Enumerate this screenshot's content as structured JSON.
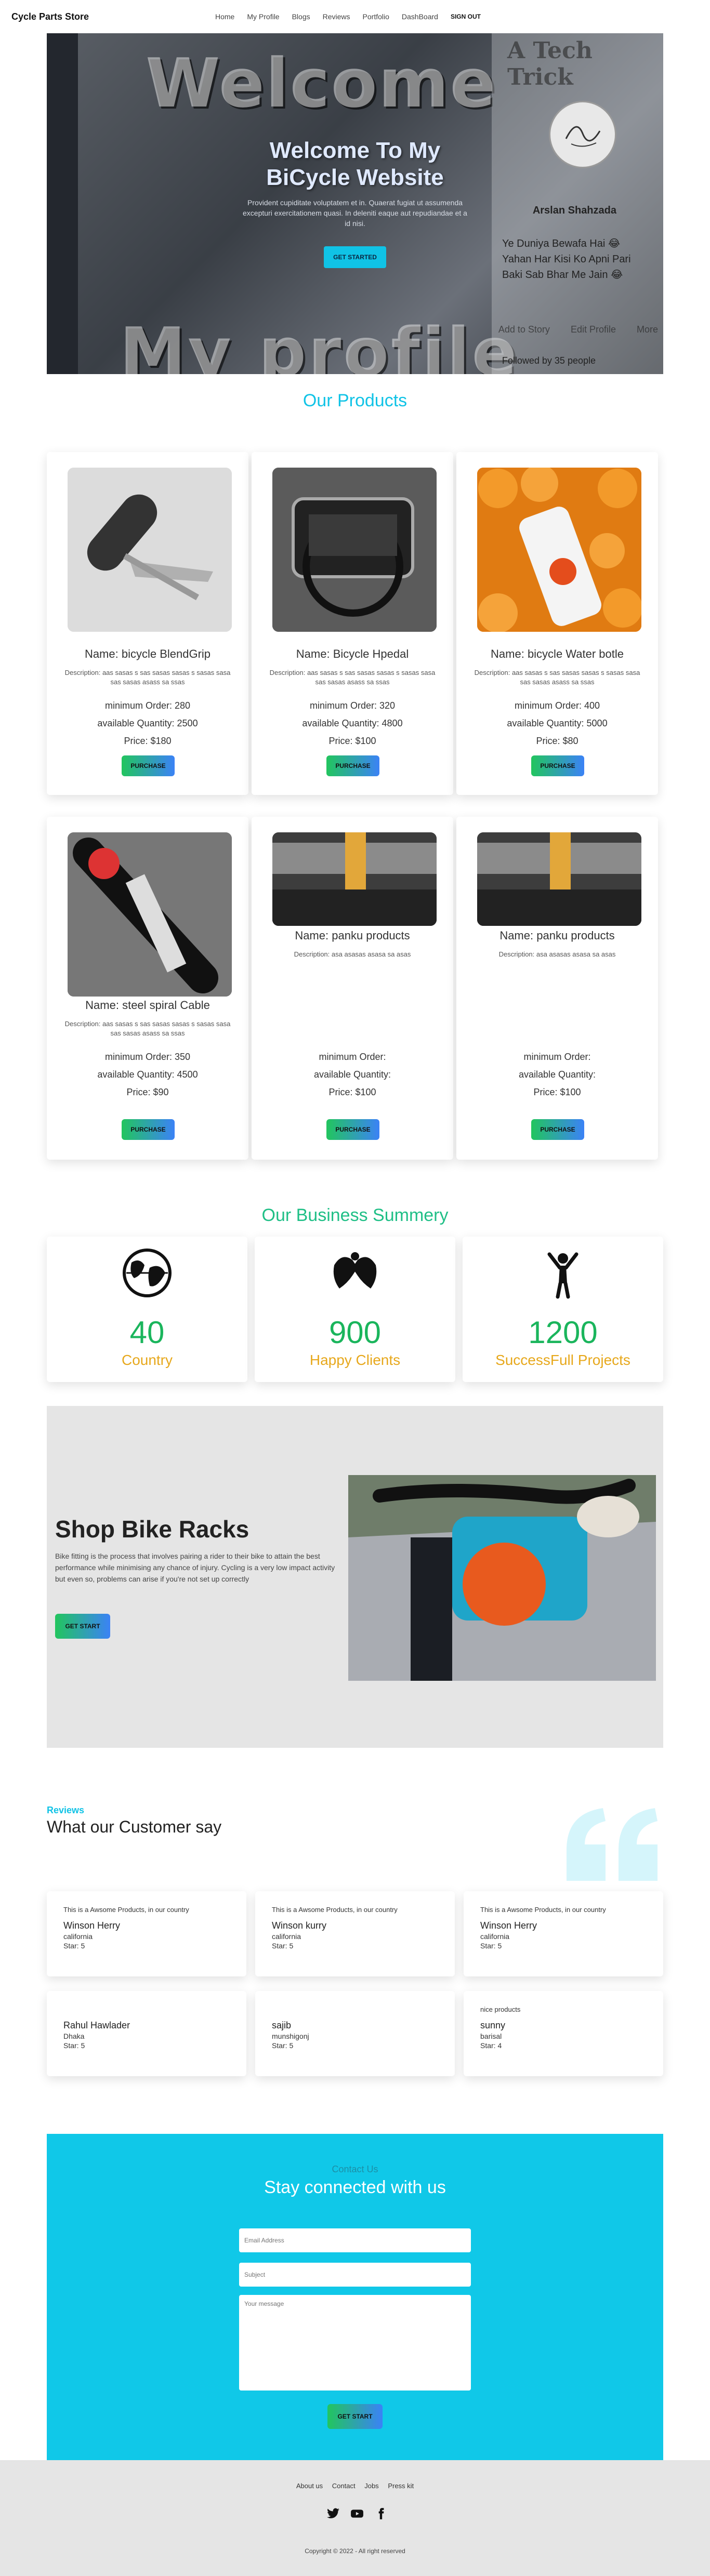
{
  "navbar": {
    "brand": "Cycle Parts Store",
    "links": [
      "Home",
      "My Profile",
      "Blogs",
      "Reviews",
      "Portfolio",
      "DashBoard"
    ],
    "signout": "SIGN OUT"
  },
  "hero": {
    "title_line1": "Welcome To My",
    "title_line2": "BiCycle Website",
    "subtitle": "Provident cupiditate voluptatem et in. Quaerat fugiat ut assumenda excepturi exercitationem quasi. In deleniti eaque aut repudiandae et a id nisi.",
    "button": "GET STARTED",
    "bg_word1": "Welcome",
    "bg_word2": "My profile",
    "side_tag": "A Tech Trick",
    "profile_name": "Arslan Shahzada",
    "profile_quote": "Ye Duniya Bewafa Hai 😂 Yahan Har Kisi Ko Apni Pari Baki Sab Bhar Me Jain 😂",
    "profile_actions": [
      "Add to Story",
      "Edit Profile",
      "More"
    ],
    "followers": "Followed by 35 people"
  },
  "products_section": {
    "title": "Our Products",
    "labels": {
      "name": "Name:",
      "description": "Description:",
      "min_order": "minimum Order:",
      "available": "available Quantity:",
      "price": "Price:",
      "button": "PURCHASE"
    },
    "items": [
      {
        "name": "bicycle BlendGrip",
        "description": "aas sasas s sas sasas sasas s sasas sasa sas sasas asass sa ssas",
        "min_order": "280",
        "available": "2500",
        "price": "$180"
      },
      {
        "name": "Bicycle Hpedal",
        "description": "aas sasas s sas sasas sasas s sasas sasa sas sasas asass sa ssas",
        "min_order": "320",
        "available": "4800",
        "price": "$100"
      },
      {
        "name": "bicycle Water botle",
        "description": "aas sasas s sas sasas sasas s sasas sasa sas sasas asass sa ssas",
        "min_order": "400",
        "available": "5000",
        "price": "$80"
      },
      {
        "name": "steel spiral Cable",
        "description": "aas sasas s sas sasas sasas s sasas sasa sas sasas asass sa ssas",
        "min_order": "350",
        "available": "4500",
        "price": "$90"
      },
      {
        "name": "panku products",
        "description": "asa asasas asasa sa asas",
        "min_order": "",
        "available": "",
        "price": "$100"
      },
      {
        "name": "panku products",
        "description": "asa asasas asasa sa asas",
        "min_order": "",
        "available": "",
        "price": "$100"
      }
    ]
  },
  "summary": {
    "title": "Our Business Summery",
    "items": [
      {
        "icon": "globe-icon",
        "number": "40",
        "label": "Country"
      },
      {
        "icon": "handshake-icon",
        "number": "900",
        "label": "Happy Clients"
      },
      {
        "icon": "person-cheering-icon",
        "number": "1200",
        "label": "SuccessFull Projects"
      }
    ]
  },
  "racks": {
    "title": "Shop Bike Racks",
    "text": "Bike fitting is the process that involves pairing a rider to their bike to attain the best performance while minimising any chance of injury. Cycling is a very low impact activity but even so, problems can arise if you're not set up correctly",
    "button": "GET START"
  },
  "reviews": {
    "kicker": "Reviews",
    "title": "What our Customer say",
    "star_label": "Star:",
    "items": [
      {
        "text": "This is a Awsome Products, in our country",
        "name": "Winson Herry",
        "city": "california",
        "star": "5"
      },
      {
        "text": "This is a Awsome Products, in our country",
        "name": "Winson kurry",
        "city": "california",
        "star": "5"
      },
      {
        "text": "This is a Awsome Products, in our country",
        "name": "Winson Herry",
        "city": "california",
        "star": "5"
      },
      {
        "text": "",
        "name": "Rahul Hawlader",
        "city": "Dhaka",
        "star": "5"
      },
      {
        "text": "",
        "name": "sajib",
        "city": "munshigonj",
        "star": "5"
      },
      {
        "text": "nice products",
        "name": "sunny",
        "city": "barisal",
        "star": "4"
      }
    ]
  },
  "contact": {
    "kicker": "Contact Us",
    "title": "Stay connected with us",
    "email_placeholder": "Email Address",
    "subject_placeholder": "Subject",
    "message_placeholder": "Your message",
    "button": "GET START"
  },
  "footer": {
    "links": [
      "About us",
      "Contact",
      "Jobs",
      "Press kit"
    ],
    "social": [
      "twitter-icon",
      "youtube-icon",
      "facebook-icon"
    ],
    "copyright": "Copyright © 2022 - All right reserved"
  },
  "colors": {
    "accent": "#10c3e6",
    "green": "#1ab55c",
    "gold": "#e7a81c"
  }
}
